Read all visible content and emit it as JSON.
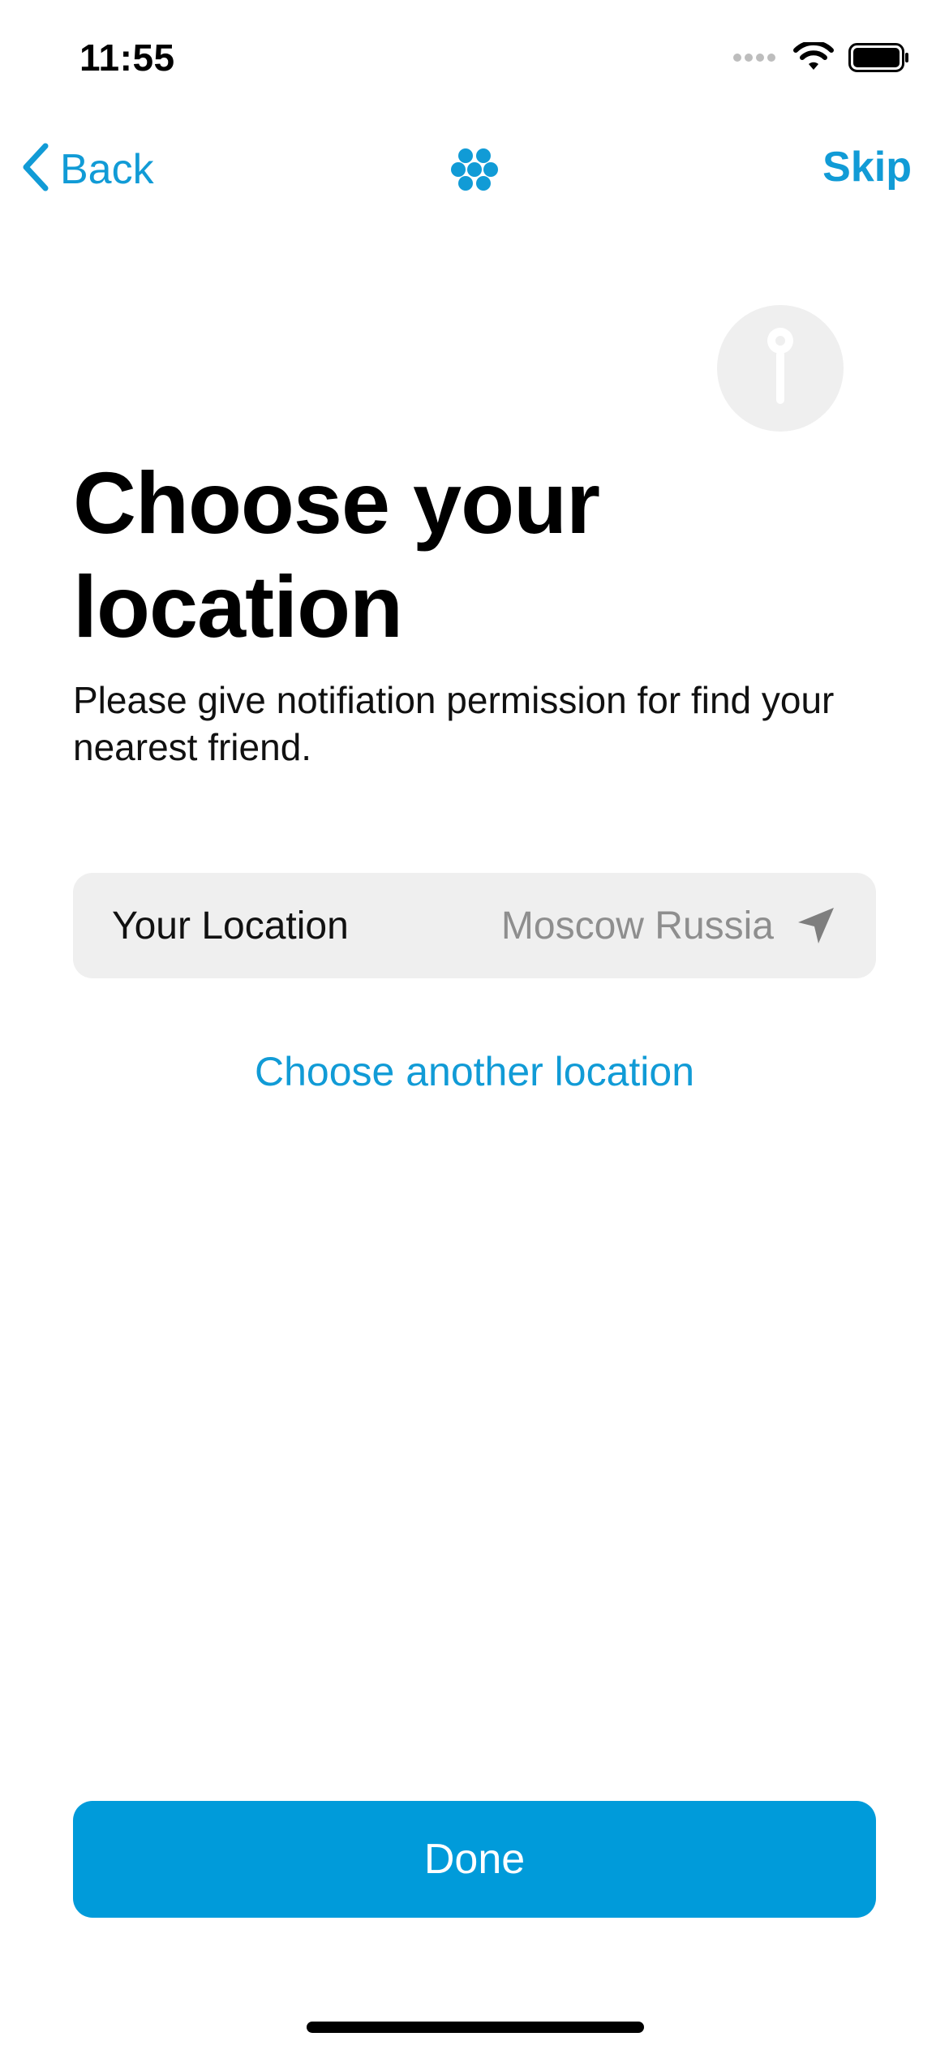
{
  "status_bar": {
    "time": "11:55"
  },
  "nav": {
    "back_label": "Back",
    "skip_label": "Skip",
    "logo_icon": "flower-dots-icon",
    "accent_color": "#119BD6"
  },
  "main": {
    "illustration_icon": "location-pin-icon",
    "title": "Choose your location",
    "description": "Please give notifiation permission for find your nearest friend.",
    "location_row": {
      "label": "Your Location",
      "value": "Moscow Russia",
      "icon": "navigation-arrow-icon"
    },
    "choose_another_label": "Choose another location"
  },
  "footer": {
    "done_label": "Done",
    "button_color": "#009BDA"
  }
}
